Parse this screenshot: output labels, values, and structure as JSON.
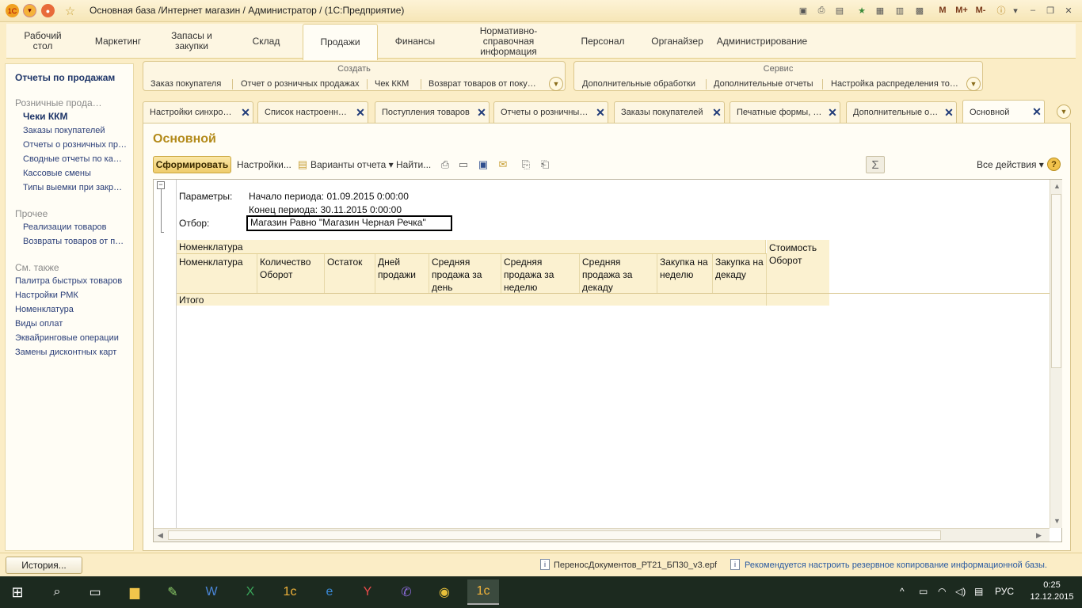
{
  "window": {
    "title": "Основная база /Интернет магазин / Администратор /  (1С:Предприятие)",
    "right_buttons": [
      "M",
      "M+",
      "M-"
    ]
  },
  "sections": [
    {
      "label": "Рабочий стол",
      "active": false
    },
    {
      "label": "Маркетинг",
      "active": false
    },
    {
      "label": "Запасы и закупки",
      "active": false
    },
    {
      "label": "Склад",
      "active": false
    },
    {
      "label": "Продажи",
      "active": true
    },
    {
      "label": "Финансы",
      "active": false
    },
    {
      "label": "Нормативно-справочная информация",
      "active": false
    },
    {
      "label": "Персонал",
      "active": false
    },
    {
      "label": "Органайзер",
      "active": false
    },
    {
      "label": "Администрирование",
      "active": false
    }
  ],
  "nav": {
    "head": "Отчеты по продажам",
    "group1": "Розничные прода…",
    "group1_items": [
      "Чеки ККМ",
      "Заказы покупателей",
      "Отчеты о розничных пр…",
      "Сводные отчеты по ка…",
      "Кассовые смены",
      "Типы выемки при закр…"
    ],
    "group2": "Прочее",
    "group2_items": [
      "Реализации товаров",
      "Возвраты товаров от п…"
    ],
    "group3": "См. также",
    "group3_items": [
      "Палитра быстрых товаров",
      "Настройки РМК",
      "Номенклатура",
      "Виды оплат",
      "Эквайринговые операции",
      "Замены дисконтных карт"
    ]
  },
  "create_panel": {
    "title": "Создать",
    "items": [
      "Заказ покупателя",
      "Отчет о розничных продажах",
      "Чек ККМ",
      "Возврат товаров от поку…"
    ]
  },
  "service_panel": {
    "title": "Сервис",
    "items": [
      "Дополнительные обработки",
      "Дополнительные отчеты",
      "Настройка распределения то…"
    ]
  },
  "tabs": [
    {
      "label": "Настройки синхро…",
      "active": false
    },
    {
      "label": "Список настроенн…",
      "active": false
    },
    {
      "label": "Поступления товаров",
      "active": false
    },
    {
      "label": "Отчеты о розничны…",
      "active": false
    },
    {
      "label": "Заказы покупателей",
      "active": false
    },
    {
      "label": "Печатные формы, …",
      "active": false
    },
    {
      "label": "Дополнительные о…",
      "active": false
    },
    {
      "label": "Основной",
      "active": true
    }
  ],
  "form": {
    "title": "Основной",
    "commands": {
      "generate": "Сформировать",
      "settings": "Настройки...",
      "variants": "Варианты отчета",
      "find": "Найти...",
      "all_actions": "Все действия"
    }
  },
  "report": {
    "params_label": "Параметры:",
    "period_start": "Начало периода: 01.09.2015 0:00:00",
    "period_end": "Конец периода: 30.11.2015 0:00:00",
    "filter_label": "Отбор:",
    "filter_value": "Магазин Равно \"Магазин Черная Речка\"",
    "group_header": "Номенклатура",
    "cost_header": "Стоимость Оборот",
    "columns": [
      "Номенклатура",
      "Количество Оборот",
      "Остаток",
      "Дней продажи",
      "Средняя продажа за день",
      "Средняя продажа за неделю",
      "Средняя продажа за декаду",
      "Закупка на неделю",
      "Закупка на декаду"
    ],
    "total_label": "Итого"
  },
  "status": {
    "history": "История...",
    "file": "ПереносДокументов_РТ21_БП30_v3.epf",
    "warning": "Рекомендуется настроить резервное копирование информационной базы."
  },
  "taskbar": {
    "lang": "РУС",
    "time": "0:25",
    "date": "12.12.2015"
  }
}
